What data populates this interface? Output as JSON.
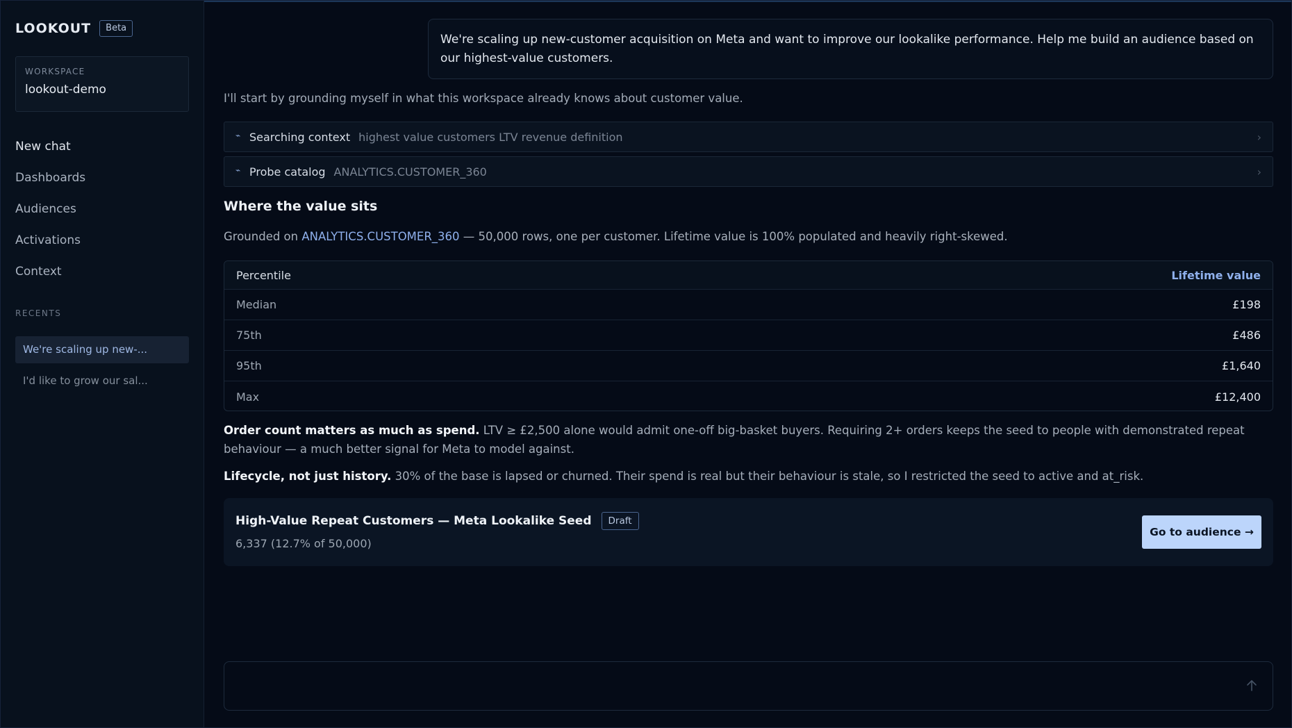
{
  "sidebar": {
    "brand": "LOOKOUT",
    "badge": "Beta",
    "workspace_label": "WORKSPACE",
    "workspace_value": "lookout-demo",
    "nav": [
      "New chat",
      "Dashboards",
      "Audiences",
      "Activations",
      "Context"
    ],
    "recents_label": "RECENTS",
    "recents": [
      "We're scaling up new-...",
      "I'd like to grow our sal..."
    ]
  },
  "chat": {
    "user_message": "We're scaling up new-customer acquisition on Meta and want to improve our lookalike performance. Help me build an audience based on our highest-value customers.",
    "intro": "I'll start by grounding myself in what this workspace already knows about customer value.",
    "tools": [
      {
        "name": "Searching context",
        "arg": "highest value customers LTV revenue definition"
      },
      {
        "name": "Probe catalog",
        "arg": "ANALYTICS.CUSTOMER_360"
      }
    ],
    "section_title": "Where the value sits",
    "grounded_prefix": "Grounded on ",
    "grounded_link": "ANALYTICS.CUSTOMER_360",
    "grounded_suffix": " — 50,000 rows, one per customer. Lifetime value is 100% populated and heavily right-skewed.",
    "table": {
      "headers": [
        "Percentile",
        "Lifetime value"
      ],
      "rows": [
        [
          "Median",
          "£198"
        ],
        [
          "75th",
          "£486"
        ],
        [
          "95th",
          "£1,640"
        ],
        [
          "Max",
          "£12,400"
        ]
      ]
    },
    "para1_bold": "Order count matters as much as spend.",
    "para1_text": " LTV ≥ £2,500 alone would admit one-off big-basket buyers. Requiring 2+ orders keeps the seed to people with demonstrated repeat behaviour — a much better signal for Meta to model against.",
    "para2_bold": "Lifecycle, not just history.",
    "para2_text": " 30% of the base is lapsed or churned. Their spend is real but their behaviour is stale, so I restricted the seed to active and at_risk.",
    "card": {
      "title": "High-Value Repeat Customers — Meta Lookalike Seed",
      "badge": "Draft",
      "sub": "6,337 (12.7% of 50,000)",
      "button": "Go to audience →"
    }
  },
  "composer": {
    "placeholder": ""
  },
  "icons": {
    "tool": "sparkle-icon",
    "chevron": "chevron-right-icon",
    "send": "arrow-up-icon"
  },
  "colors": {
    "accent": "#bcd5fb",
    "link": "#8fb0ec",
    "background": "#050b17"
  }
}
